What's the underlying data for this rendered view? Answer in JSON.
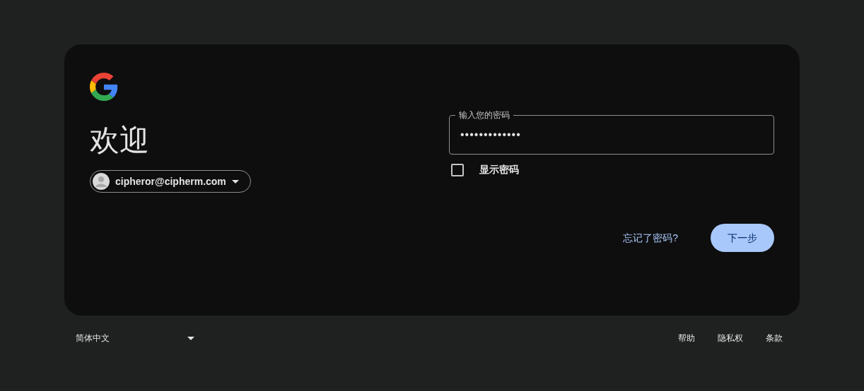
{
  "title": "欢迎",
  "account": {
    "email": "cipheror@cipherm.com"
  },
  "password": {
    "label": "输入您的密码",
    "value": "•••••••••••••"
  },
  "show_password": {
    "label": "显示密码",
    "checked": false
  },
  "forgot_link": "忘记了密码?",
  "next_button": "下一步",
  "footer": {
    "language": "简体中文",
    "links": [
      "帮助",
      "隐私权",
      "条款"
    ]
  }
}
